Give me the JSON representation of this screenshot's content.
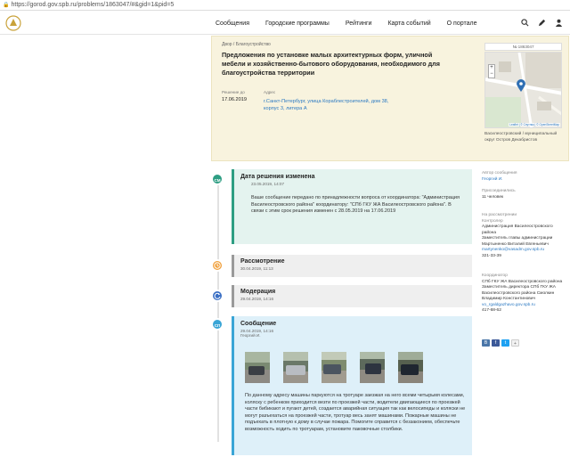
{
  "browser": {
    "url": "https://gorod.gov.spb.ru/problems/1863047/#&gid=1&pid=5"
  },
  "nav": {
    "items": [
      "Сообщения",
      "Городские программы",
      "Рейтинги",
      "Карта событий",
      "О портале"
    ],
    "icons": [
      "search-icon",
      "edit-icon",
      "user-icon"
    ]
  },
  "problem": {
    "breadcrumb": "Двор / Благоустройство",
    "title": "Предложения по установке малых архитектурных форм, уличной мебели и хозяйственно-бытового оборудования, необходимого для благоустройства территории",
    "decision_label": "Решение до",
    "decision_date": "17.06.2019",
    "address_label": "Адрес",
    "address": "г.Санкт-Петербург, улица Кораблестроителей, дом 38, корпус 3, литера А",
    "number": "№ 1863047",
    "map_attribution": "Leaflet | © Спутник | © OpenStreetMap",
    "district": "Василеостровский / муниципальный округ Остров Декабристов"
  },
  "events": [
    {
      "title": "Дата решения изменена",
      "date": "23.05.2019, 14:07",
      "text": "Ваше сообщение передано по принадлежности вопроса от координатора: \"Администрация Василеостровского района\" координатору: \"СПб ГКУ ЖА Василеостровского района\". В связи с этим срок решения изменен с 28.05.2019 на 17.06.2019",
      "icon": "СМ",
      "color": "#2e9e83"
    },
    {
      "title": "Рассмотрение",
      "date": "30.04.2019, 11:13",
      "icon": "clock-icon",
      "color": "#f0a03c"
    },
    {
      "title": "Модерация",
      "date": "29.04.2019, 14:16",
      "icon": "refresh-icon",
      "color": "#3a6fc4"
    },
    {
      "title": "Сообщение",
      "date": "29.04.2019, 14:16",
      "author": "Георгий И.",
      "text": "По данному адресу машины паркуются на тротуаре заезжая на него всеми четырьмя колесами, коляску с ребенком приходится везти по проезжей части, водители двигающиеся по проезжей части бибикают и пугают детей, создается аварийная ситуация так как велосипеды и коляски не могут разъехаться на проезжей части, тротуар весь занят машинами. Пожарные машины не подъехать в плотную к дому в случае пожара. Помогите справится с беззаконием, обеспечьте возможность ходить по тротуарам, установите паковочные столбики.",
      "icon": "СП",
      "color": "#3aa5d6"
    }
  ],
  "sidebar": {
    "author_label": "Автор сообщения",
    "author": "Георгий И.",
    "joined_label": "Присоединились",
    "joined": "11 человек",
    "review_label": "На рассмотрении",
    "controller_label": "Контролер",
    "controller_org": "Администрация Василеостровского района",
    "controller_name": "Заместитель главы администрации Мартыненко Виталий Евгеньевич",
    "controller_email": "martynenko@vasadm.gov.spb.ru",
    "controller_phone": "321-33-39",
    "coordinator_label": "Координатор",
    "coordinator_org": "СПб ГКУ ЖА Василеостровского района",
    "coordinator_name": "Заместитель директора СПб ГКУ ЖА Василеостровского района Смолкин Владимир Константинович",
    "coordinator_email": "vo_rgaldgazhavo.gov.spb.ru",
    "coordinator_phone": "417-68-62"
  }
}
